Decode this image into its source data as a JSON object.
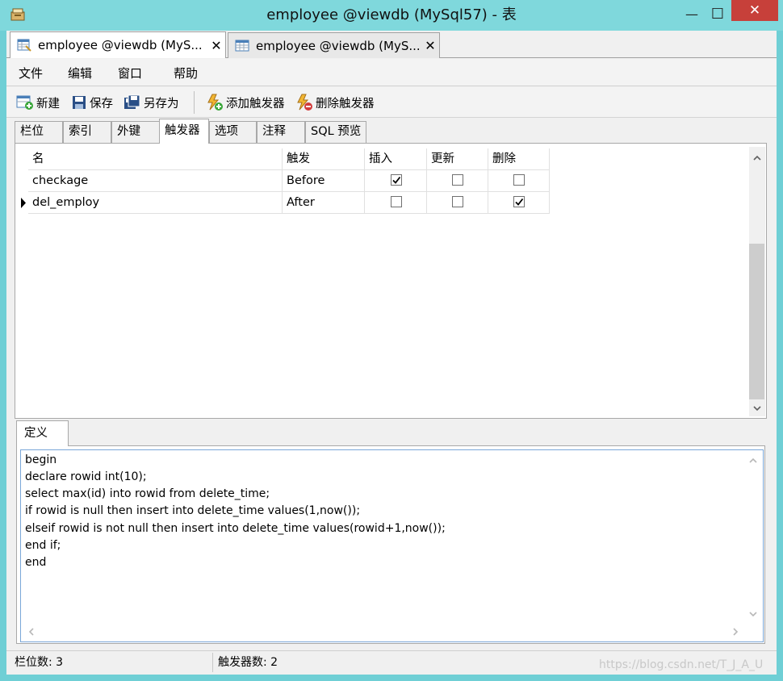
{
  "window": {
    "title": "employee @viewdb (MySql57) - 表",
    "minimize_glyph": "—",
    "maximize_glyph": "☐",
    "close_glyph": "✕"
  },
  "doc_tabs": [
    {
      "label": "employee @viewdb (MyS...",
      "icon": "table-design-icon",
      "close": "✕",
      "active": true
    },
    {
      "label": "employee @viewdb (MyS...",
      "icon": "table-data-icon",
      "close": "✕",
      "active": false
    }
  ],
  "menu": [
    "文件",
    "编辑",
    "窗口",
    "帮助"
  ],
  "toolbar": {
    "new": "新建",
    "save": "保存",
    "save_as": "另存为",
    "add_trigger": "添加触发器",
    "delete_trigger": "删除触发器"
  },
  "sub_tabs": [
    "栏位",
    "索引",
    "外键",
    "触发器",
    "选项",
    "注释",
    "SQL 预览"
  ],
  "grid": {
    "columns": [
      "名",
      "触发",
      "插入",
      "更新",
      "删除"
    ],
    "rows": [
      {
        "name": "checkage",
        "timing": "Before",
        "insert": true,
        "update": false,
        "delete": false,
        "current": false
      },
      {
        "name": "del_employ",
        "timing": "After",
        "insert": false,
        "update": false,
        "delete": true,
        "current": true
      }
    ]
  },
  "definition": {
    "tab_label": "定义",
    "lines": [
      "begin",
      "declare rowid int(10);",
      "select max(id) into rowid from delete_time;",
      "if rowid is null then insert into delete_time values(1,now());",
      "elseif rowid is not null then insert into delete_time values(rowid+1,now());",
      "end if;",
      "end"
    ]
  },
  "status": {
    "field_count": "栏位数: 3",
    "trigger_count": "触发器数: 2",
    "watermark": "https://blog.csdn.net/T_J_A_U"
  },
  "colors": {
    "title_bar": "#7fd8dc",
    "close_button": "#c7403a",
    "editor_border": "#7aa7d8"
  }
}
